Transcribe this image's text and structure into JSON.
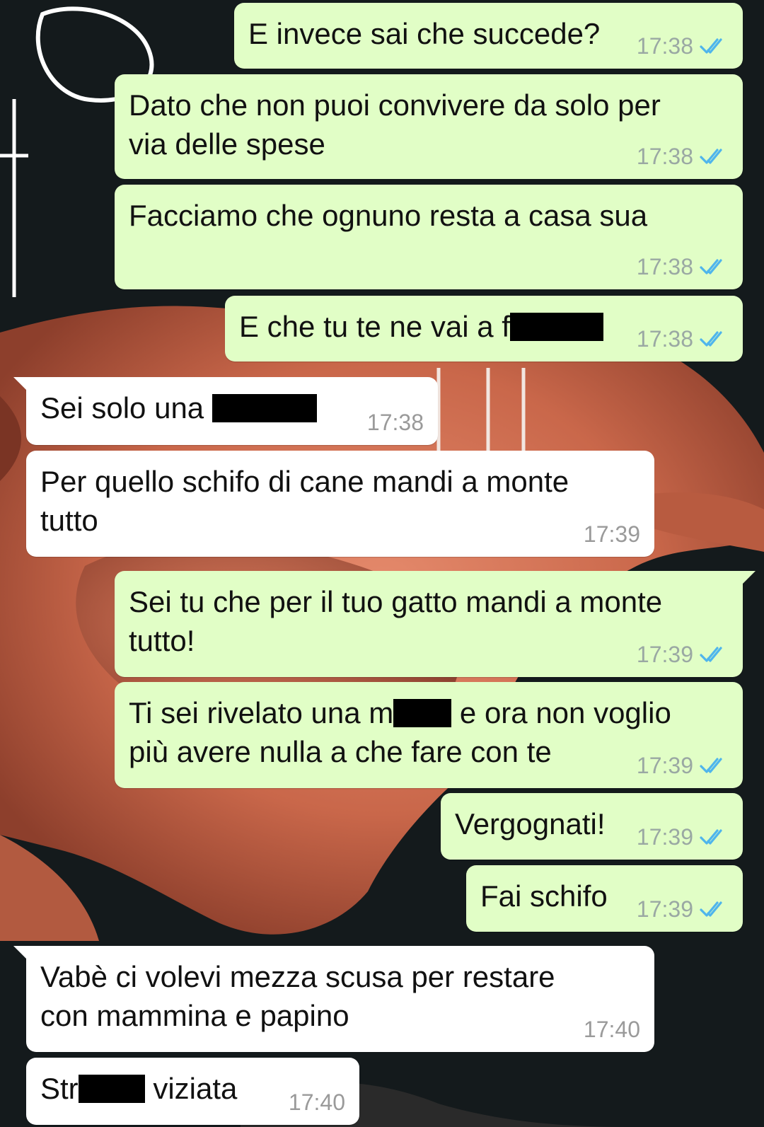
{
  "chat": {
    "messages": [
      {
        "id": "m1",
        "dir": "out",
        "lines": [
          "E invece sai che succede?"
        ],
        "time": "17:38",
        "status": "read"
      },
      {
        "id": "m2",
        "dir": "out",
        "lines": [
          "Dato che non puoi convivere da solo per",
          "via delle spese"
        ],
        "time": "17:38",
        "status": "read"
      },
      {
        "id": "m3",
        "dir": "out",
        "lines": [
          "Facciamo che ognuno resta a casa sua"
        ],
        "time": "17:38",
        "status": "read"
      },
      {
        "id": "m4",
        "dir": "out",
        "lines": [
          "E che tu te ne vai a f"
        ],
        "time": "17:38",
        "status": "read",
        "redacted": true
      },
      {
        "id": "m5",
        "dir": "in",
        "lines": [
          "Sei solo una"
        ],
        "time": "17:38",
        "redacted": true
      },
      {
        "id": "m6",
        "dir": "in",
        "lines": [
          "Per quello schifo di cane mandi a monte",
          "tutto"
        ],
        "time": "17:39"
      },
      {
        "id": "m7",
        "dir": "out",
        "lines": [
          "Sei tu che per il tuo gatto mandi a monte",
          "tutto!"
        ],
        "time": "17:39",
        "status": "read"
      },
      {
        "id": "m8",
        "dir": "out",
        "lines": [
          "Ti sei rivelato una m",
          "e ora non voglio",
          "più avere nulla a che fare con te"
        ],
        "time": "17:39",
        "status": "read",
        "redacted": true
      },
      {
        "id": "m9",
        "dir": "out",
        "lines": [
          "Vergognati!"
        ],
        "time": "17:39",
        "status": "read"
      },
      {
        "id": "m10",
        "dir": "out",
        "lines": [
          "Fai schifo"
        ],
        "time": "17:39",
        "status": "read"
      },
      {
        "id": "m11",
        "dir": "in",
        "lines": [
          "Vabè ci volevi mezza scusa per restare",
          "con mammina e papino"
        ],
        "time": "17:40"
      },
      {
        "id": "m12",
        "dir": "in",
        "lines": [
          "Str",
          "viziata"
        ],
        "time": "17:40",
        "redacted": true
      }
    ]
  },
  "colors": {
    "outgoing_bubble": "#e1fec6",
    "incoming_bubble": "#ffffff",
    "read_ticks": "#4fb5ec",
    "timestamp": "#9aa8a3",
    "wallpaper_dark": "#141a1c",
    "wallpaper_flower": "#c9674a"
  },
  "icons": {
    "read_receipt": "double-check-icon"
  }
}
